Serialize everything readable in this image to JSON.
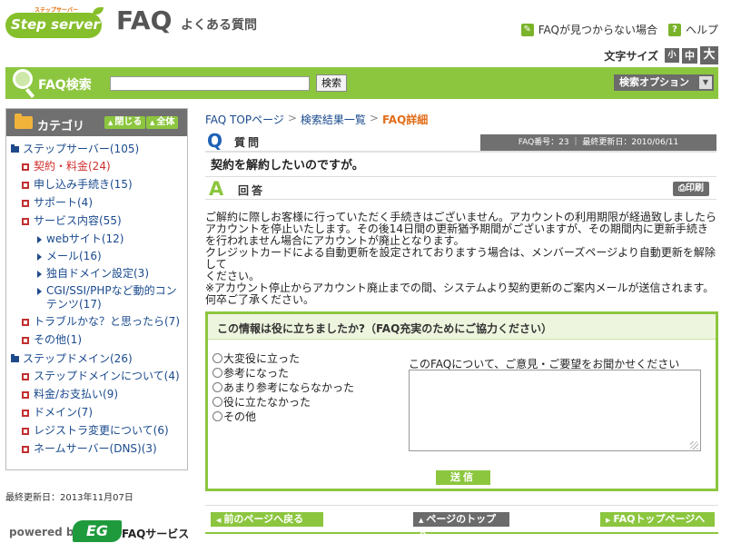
{
  "header": {
    "logo_tagline": "ステップサーバー",
    "logo_text": "Step server",
    "title": "FAQ",
    "subtitle": "よくある質問",
    "link_not_found": "FAQが見つからない場合",
    "link_help": "ヘルプ",
    "help_icon_glyph": "?",
    "font_size_label": "文字サイズ",
    "font_small": "小",
    "font_medium": "中",
    "font_large": "大"
  },
  "search": {
    "label": "FAQ検索",
    "value": "",
    "button": "検索",
    "option": "検索オプション"
  },
  "sidebar": {
    "title": "カテゴリ",
    "close": "閉じる",
    "all": "全体",
    "categories": [
      {
        "label": "ステップサーバー(105)",
        "level": 0
      },
      {
        "label": "契約・料金(24)",
        "level": 1,
        "current": true
      },
      {
        "label": "申し込み手続き(15)",
        "level": 1
      },
      {
        "label": "サポート(4)",
        "level": 1
      },
      {
        "label": "サービス内容(55)",
        "level": 1
      },
      {
        "label": "webサイト(12)",
        "level": 2
      },
      {
        "label": "メール(16)",
        "level": 2
      },
      {
        "label": "独自ドメイン設定(3)",
        "level": 2
      },
      {
        "label": "CGI/SSI/PHPなど動的コンテンツ(17)",
        "level": 2
      },
      {
        "label": "トラブルかな？と思ったら(7)",
        "level": 1
      },
      {
        "label": "その他(1)",
        "level": 1
      },
      {
        "label": "ステップドメイン(26)",
        "level": 0
      },
      {
        "label": "ステップドメインについて(4)",
        "level": 1
      },
      {
        "label": "料金/お支払い(9)",
        "level": 1
      },
      {
        "label": "ドメイン(7)",
        "level": 1
      },
      {
        "label": "レジストラ変更について(6)",
        "level": 1
      },
      {
        "label": "ネームサーバー(DNS)(3)",
        "level": 1
      }
    ],
    "updated": "最終更新日：2013年11月07日",
    "powered_by": "powered by",
    "powered_logo": "EG",
    "powered_service": "FAQサービス"
  },
  "breadcrumb": {
    "top": "FAQ TOPページ",
    "results": "検索結果一覧",
    "current": "FAQ詳細",
    "sep": ">"
  },
  "question": {
    "icon": "Q",
    "label": "質問",
    "meta": "FAQ番号：23 ｜ 最終更新日：2010/06/11",
    "text": "契約を解約したいのですが。"
  },
  "answer": {
    "icon": "A",
    "label": "回答",
    "print": "印刷",
    "lines": [
      "ご解約に際しお客様に行っていただく手続きはございません。アカウントの利用期限が経過致しましたら",
      "アカウントを停止いたします。その後14日間の更新猶予期間がございますが、その期間内に更新手続き",
      "を行われません場合にアカウントが廃止となります。",
      "クレジットカードによる自動更新を設定されておりますう場合は、メンバーズページより自動更新を解除して",
      "ください。",
      "※アカウント停止からアカウント廃止までの間、システムより契約更新のご案内メールが送信されます。",
      "何卒ご了承ください。"
    ]
  },
  "feedback": {
    "title": "この情報は役に立ちましたか?（FAQ充実のためにご協力ください）",
    "options": [
      "大変役に立った",
      "参考になった",
      "あまり参考にならなかった",
      "役に立たなかった",
      "その他"
    ],
    "comment_label": "このFAQについて、ご意見・ご要望をお聞かせください",
    "comment_value": "",
    "submit": "送信"
  },
  "nav": {
    "prev": "前のページへ戻る",
    "page_top": "ページのトップへ",
    "faq_top": "FAQトップページへ"
  },
  "colors": {
    "accent": "#8cc63f",
    "dark_gray": "#6b6b6b",
    "link": "#1a4a8e",
    "current": "#e26d19",
    "question_blue": "#1d62b5"
  }
}
